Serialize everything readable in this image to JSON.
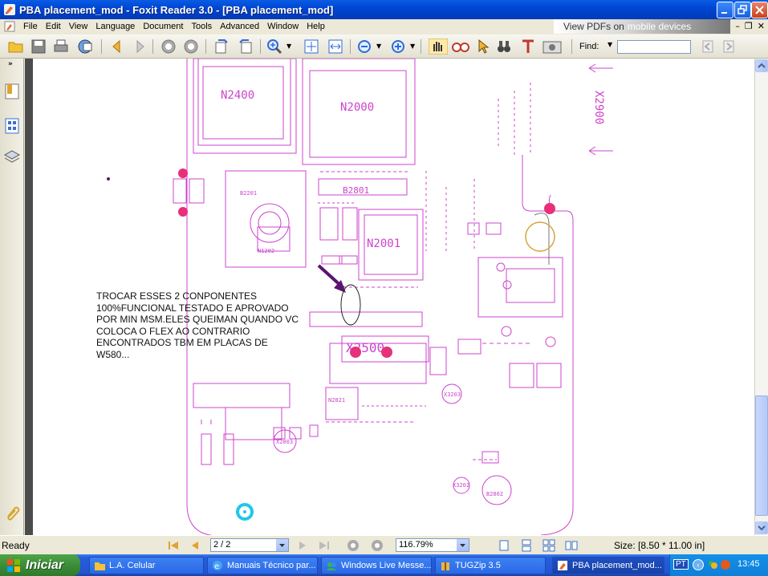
{
  "window": {
    "title": "PBA placement_mod - Foxit Reader 3.0 - [PBA placement_mod]"
  },
  "menu": [
    "File",
    "Edit",
    "View",
    "Language",
    "Document",
    "Tools",
    "Advanced",
    "Window",
    "Help"
  ],
  "ad_banner": {
    "text": "View PDFs on",
    "highlight": "mobile devices"
  },
  "toolbar": {
    "find_label": "Find:",
    "find_value": ""
  },
  "document": {
    "note": "TROCAR ESSES 2 CONPONENTES\n100%FUNCIONAL TESTADO E APROVADO\nPOR MIN MSM.ELES QUEIMAN QUANDO VC\nCOLOCA O FLEX AO CONTRARIO\nENCONTRADOS TBM EM PLACAS DE\nW580...",
    "chip_labels": [
      "N2400",
      "N2000",
      "N2001",
      "B2801",
      "X2500",
      "X2900",
      "N2821",
      "B2802",
      "X3202",
      "X3203",
      "N1202",
      "B2201",
      "X2803"
    ],
    "accent_magenta": "#cc44cc",
    "pad_pink": "#e8307a"
  },
  "statusbar": {
    "status": "Ready",
    "page": "2 / 2",
    "zoom": "116.79%",
    "size": "Size: [8.50 * 11.00 in]"
  },
  "taskbar": {
    "start": "Iniciar",
    "tasks": [
      {
        "label": "L.A. Celular",
        "icon": "folder-icon"
      },
      {
        "label": "Manuais Técnico par...",
        "icon": "ie-icon"
      },
      {
        "label": "Windows Live Messe...",
        "icon": "messenger-icon"
      },
      {
        "label": "TUGZip 3.5",
        "icon": "zip-icon"
      },
      {
        "label": "PBA placement_mod...",
        "icon": "foxit-icon",
        "active": true
      }
    ],
    "lang": "PT",
    "clock": "13:45"
  }
}
